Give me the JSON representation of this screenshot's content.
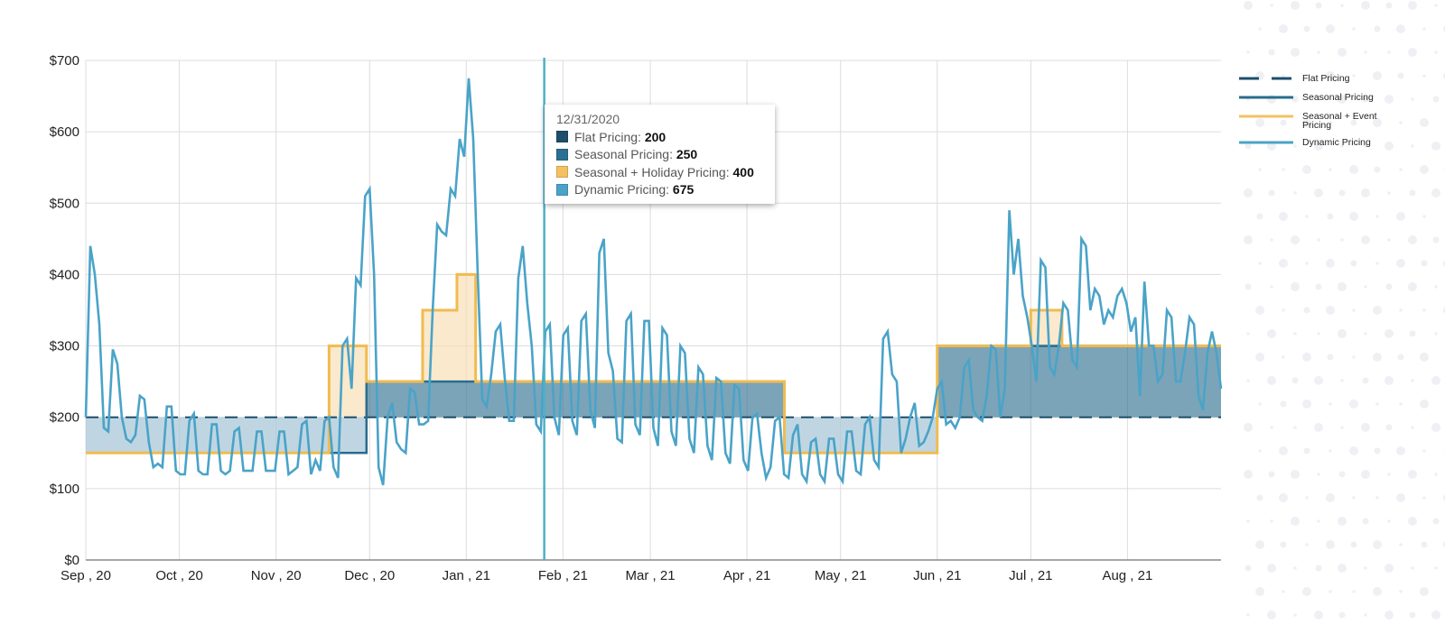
{
  "chart_data": {
    "type": "line",
    "title": "",
    "xlabel": "",
    "ylabel": "",
    "ylim": [
      0,
      700
    ],
    "x_range": [
      "2020-09-01",
      "2021-08-31"
    ],
    "y_ticks": [
      "$0",
      "$100",
      "$200",
      "$300",
      "$400",
      "$500",
      "$600",
      "$700"
    ],
    "x_ticks": [
      "Sep , 20",
      "Oct , 20",
      "Nov , 20",
      "Dec , 20",
      "Jan , 21",
      "Feb , 21",
      "Mar , 21",
      "Apr , 21",
      "May , 21",
      "Jun , 21",
      "Jul , 21",
      "Aug , 21"
    ],
    "grid": true,
    "legend_position": "right",
    "cursor_date": "2021-01-26",
    "series": [
      {
        "name": "Flat Pricing",
        "style": "dashed",
        "color": "#1d4e6b",
        "steps": [
          {
            "from": "2020-09-01",
            "to": "2021-08-31",
            "value": 200
          }
        ]
      },
      {
        "name": "Seasonal Pricing",
        "style": "solid",
        "color": "#2a6c8e",
        "steps": [
          {
            "from": "2020-09-01",
            "to": "2020-11-30",
            "value": 150
          },
          {
            "from": "2020-11-30",
            "to": "2021-04-13",
            "value": 250
          },
          {
            "from": "2021-04-13",
            "to": "2021-06-01",
            "value": 150
          },
          {
            "from": "2021-06-01",
            "to": "2021-08-31",
            "value": 300
          }
        ]
      },
      {
        "name": "Seasonal + Event Pricing",
        "style": "solid",
        "color": "#f1bb4f",
        "steps": [
          {
            "from": "2020-09-01",
            "to": "2020-11-18",
            "value": 150
          },
          {
            "from": "2020-11-18",
            "to": "2020-11-30",
            "value": 300
          },
          {
            "from": "2020-11-30",
            "to": "2020-12-18",
            "value": 250
          },
          {
            "from": "2020-12-18",
            "to": "2020-12-29",
            "value": 350
          },
          {
            "from": "2020-12-29",
            "to": "2021-01-04",
            "value": 400
          },
          {
            "from": "2021-01-04",
            "to": "2021-04-13",
            "value": 250
          },
          {
            "from": "2021-04-13",
            "to": "2021-06-01",
            "value": 150
          },
          {
            "from": "2021-06-01",
            "to": "2021-07-01",
            "value": 300
          },
          {
            "from": "2021-07-01",
            "to": "2021-07-11",
            "value": 350
          },
          {
            "from": "2021-07-11",
            "to": "2021-08-31",
            "value": 300
          }
        ]
      },
      {
        "name": "Dynamic Pricing",
        "style": "solid",
        "color": "#4aa3c8",
        "start": "2020-09-01",
        "step_days": 2.5,
        "values": [
          200,
          440,
          400,
          330,
          185,
          180,
          295,
          275,
          200,
          170,
          165,
          175,
          230,
          225,
          165,
          130,
          135,
          130,
          215,
          215,
          125,
          120,
          120,
          195,
          205,
          125,
          120,
          120,
          190,
          190,
          125,
          120,
          125,
          180,
          185,
          125,
          125,
          125,
          180,
          180,
          125,
          125,
          125,
          180,
          180,
          120,
          125,
          130,
          190,
          195,
          120,
          140,
          125,
          195,
          200,
          130,
          115,
          300,
          310,
          240,
          395,
          385,
          510,
          520,
          400,
          130,
          105,
          200,
          220,
          165,
          155,
          150,
          240,
          235,
          190,
          190,
          195,
          350,
          470,
          460,
          455,
          520,
          510,
          590,
          565,
          675,
          590,
          400,
          225,
          215,
          260,
          320,
          330,
          255,
          195,
          195,
          395,
          440,
          360,
          300,
          190,
          180,
          320,
          330,
          200,
          175,
          315,
          325,
          195,
          175,
          335,
          345,
          210,
          185,
          430,
          450,
          290,
          265,
          170,
          165,
          335,
          345,
          190,
          175,
          335,
          335,
          185,
          160,
          325,
          315,
          180,
          160,
          300,
          290,
          170,
          150,
          270,
          260,
          160,
          140,
          255,
          250,
          150,
          135,
          245,
          240,
          140,
          125,
          200,
          205,
          150,
          115,
          130,
          195,
          200,
          120,
          115,
          175,
          190,
          120,
          110,
          165,
          170,
          120,
          110,
          170,
          170,
          120,
          110,
          180,
          180,
          125,
          120,
          190,
          200,
          140,
          130,
          310,
          320,
          260,
          250,
          150,
          170,
          200,
          220,
          160,
          165,
          180,
          200,
          240,
          250,
          190,
          195,
          185,
          200,
          270,
          280,
          210,
          200,
          195,
          230,
          300,
          295,
          200,
          240,
          490,
          400,
          450,
          370,
          340,
          300,
          250,
          420,
          410,
          270,
          260,
          300,
          360,
          350,
          280,
          270,
          450,
          440,
          350,
          380,
          370,
          330,
          350,
          340,
          370,
          380,
          360,
          320,
          340,
          230,
          390,
          300,
          300,
          250,
          260,
          350,
          340,
          250,
          250,
          290,
          340,
          330,
          230,
          210,
          290,
          320,
          290,
          240
        ]
      }
    ],
    "tooltip": {
      "date": "12/31/2020",
      "rows": [
        {
          "label": "Flat Pricing",
          "value": "200",
          "color": "#1d4e6b"
        },
        {
          "label": "Seasonal Pricing",
          "value": "250",
          "color": "#2b6f93"
        },
        {
          "label": "Seasonal + Holiday Pricing",
          "value": "400",
          "color": "#f5c060"
        },
        {
          "label": "Dynamic Pricing",
          "value": "675",
          "color": "#4aa3c8"
        }
      ]
    }
  },
  "legend": {
    "items": [
      {
        "label": "Flat Pricing",
        "style": "dashed",
        "color": "#1d4e6b"
      },
      {
        "label": "Seasonal Pricing",
        "style": "solid",
        "color": "#2a6c8e"
      },
      {
        "label": "Seasonal + Event Pricing",
        "style": "solid",
        "color": "#f5c060"
      },
      {
        "label": "Dynamic Pricing",
        "style": "solid",
        "color": "#4aa3c8"
      }
    ]
  }
}
